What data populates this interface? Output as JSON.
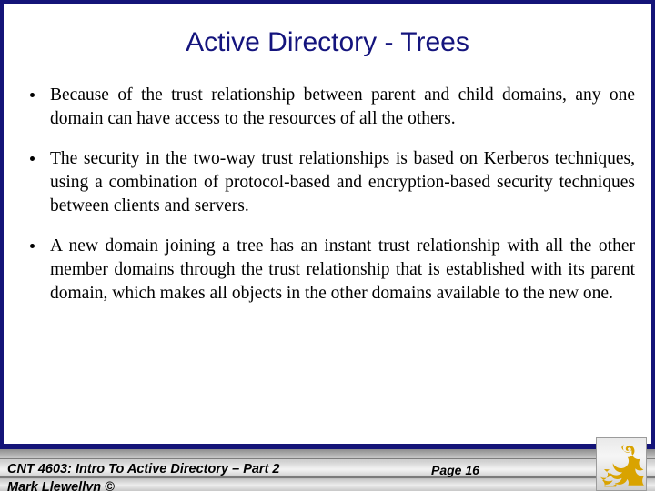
{
  "slide": {
    "title": "Active Directory - Trees",
    "title_color": "#14147d",
    "frame_color": "#141478",
    "bullets": [
      {
        "text": "Because of the trust relationship between parent and child domains, any one domain can have access to the resources of all the others."
      },
      {
        "text": "The security in the two-way trust relationships is based on Kerberos techniques, using a combination of protocol-based and encryption-based security techniques between clients and servers."
      },
      {
        "text": "A new domain joining a tree has an instant trust relationship with all the other member domains through the trust relationship that is established with its parent domain, which makes all objects in the other domains available to the new one."
      }
    ]
  },
  "footer": {
    "course": "CNT 4603: Intro To Active Directory – Part 2",
    "page": "Page 16",
    "author": "Mark Llewellyn ©",
    "logo_name": "ucf-pegasus-logo",
    "logo_color": "#d9a300"
  }
}
